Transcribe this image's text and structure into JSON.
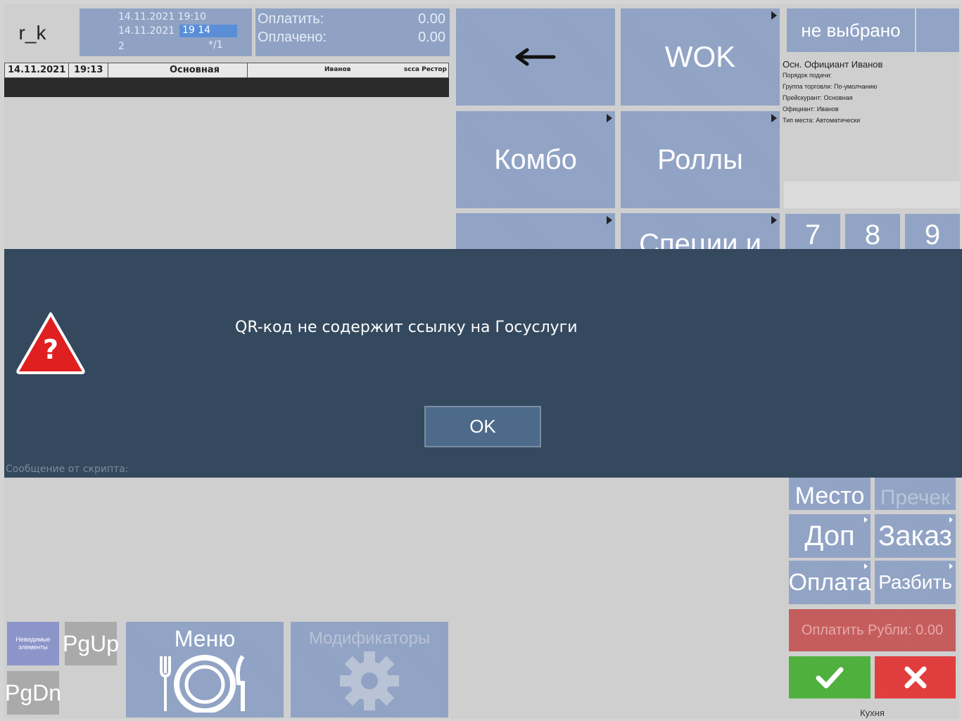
{
  "logo": "r_k",
  "order_info": {
    "open_time": "14.11.2021  19:10",
    "cur_date": "14.11.2021",
    "cur_time": "19 14",
    "guests": "2",
    "table_suffix": "*/1"
  },
  "payment": {
    "to_pay_label": "Оплатить:",
    "to_pay_value": "0.00",
    "paid_label": "Оплачено:",
    "paid_value": "0.00"
  },
  "status_bar": {
    "date": "14.11.2021",
    "time": "19:13",
    "menu_name": "Основная",
    "waiter": "Иванов",
    "restaurant": "scca Рестор"
  },
  "menu_tiles": {
    "back_icon": "arrow-left-icon",
    "wok": "WOK",
    "combo": "Комбо",
    "rolls": "Роллы",
    "empty": "",
    "spices": "Специи и"
  },
  "right_panel": {
    "not_selected": "не выбрано",
    "main_waiter_label": "Осн. Официант",
    "main_waiter_name": "Иванов",
    "info_lines": [
      "Порядок подачи:",
      "Группа торговли: По-умолчанию",
      "Прейскурант: Основная",
      "Официант: Иванов",
      "Тип места: Автоматически"
    ]
  },
  "numpad": [
    "7",
    "8",
    "9"
  ],
  "dialog": {
    "message": "QR-код не содержит ссылку на Госуслуги",
    "ok_label": "OK",
    "script_message_label": "Сообщение от скрипта:",
    "warning_icon": "question-warning-icon"
  },
  "action_buttons": {
    "place": "Место",
    "precheck": "Пречек",
    "extra": "Доп",
    "order": "Заказ",
    "payment": "Оплата",
    "split": "Разбить",
    "pay_rubles": "Оплатить Рубли: 0.00",
    "confirm_icon": "checkmark-icon",
    "cancel_icon": "cross-icon",
    "kitchen": "Кухня"
  },
  "bottom_bar": {
    "invisible_elements": "Невидимые элементы",
    "pgup": "PgUp",
    "pgdn": "PgDn",
    "menu": "Меню",
    "menu_icon": "plate-cutlery-icon",
    "modifiers": "Модификаторы",
    "modifiers_icon": "gear-icon"
  },
  "colors": {
    "tile_blue": "#8fa2c4",
    "dialog_bg": "#34495e",
    "confirm_green": "#4caf3a",
    "cancel_red": "#e03a3a",
    "pay_disabled": "#c45a5a"
  }
}
